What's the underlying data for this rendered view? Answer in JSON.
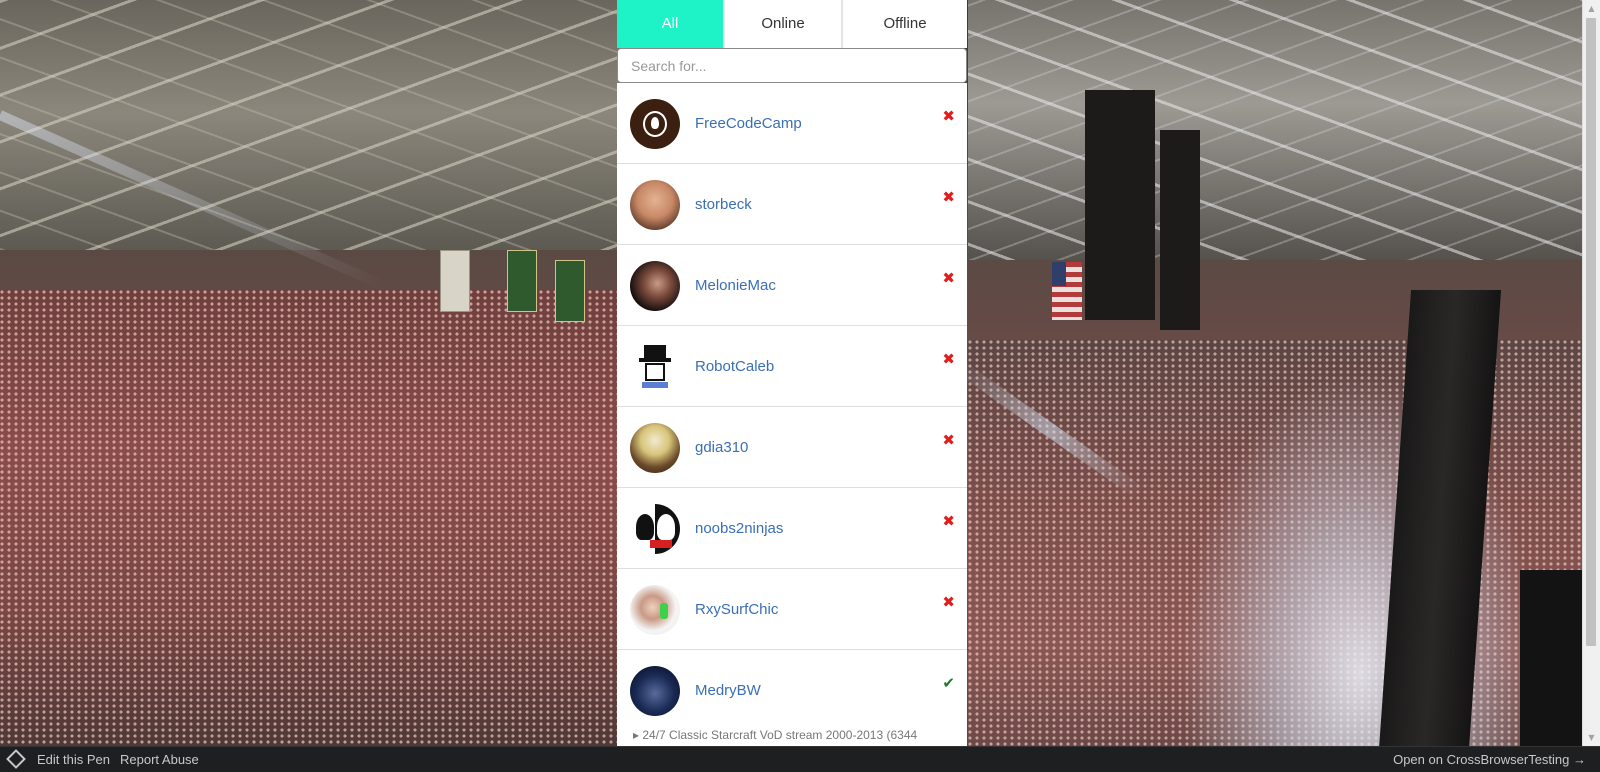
{
  "tabs": [
    {
      "label": "All",
      "active": true
    },
    {
      "label": "Online",
      "active": false
    },
    {
      "label": "Offline",
      "active": false
    }
  ],
  "search": {
    "placeholder": "Search for...",
    "value": ""
  },
  "streamers": [
    {
      "name": "FreeCodeCamp",
      "status": "offline",
      "status_icon": "cross-icon"
    },
    {
      "name": "storbeck",
      "status": "offline",
      "status_icon": "cross-icon"
    },
    {
      "name": "MelonieMac",
      "status": "offline",
      "status_icon": "cross-icon"
    },
    {
      "name": "RobotCaleb",
      "status": "offline",
      "status_icon": "cross-icon"
    },
    {
      "name": "gdia310",
      "status": "offline",
      "status_icon": "cross-icon"
    },
    {
      "name": "noobs2ninjas",
      "status": "offline",
      "status_icon": "cross-icon"
    },
    {
      "name": "RxySurfChic",
      "status": "offline",
      "status_icon": "cross-icon"
    },
    {
      "name": "MedryBW",
      "status": "online",
      "status_icon": "check-icon",
      "stream": "24/7 Classic Starcraft VoD stream 2000-2013 (6344"
    }
  ],
  "status_glyphs": {
    "offline": "✖",
    "online": "✔"
  },
  "footer": {
    "edit_label": "Edit this Pen",
    "report_label": "Report Abuse",
    "open_label": "Open on CrossBrowserTesting →"
  },
  "colors": {
    "active_tab": "#1ef2c7",
    "link": "#3a6fb3",
    "offline": "#e11d1d",
    "online": "#1f7a2a",
    "footer_bg": "#1d1f20"
  }
}
